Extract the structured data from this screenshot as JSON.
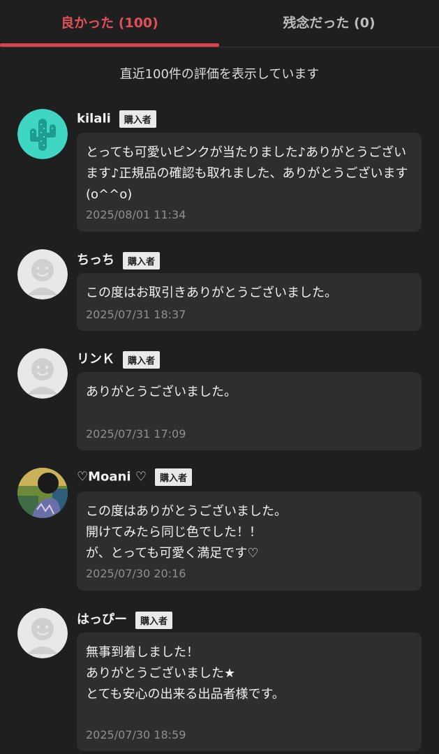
{
  "tabs": {
    "good_label": "良かった (100)",
    "bad_label": "残念だった (0)"
  },
  "notice": "直近100件の評価を表示しています",
  "badge_label": "購入者",
  "reviews": [
    {
      "name": "kilali",
      "avatar": "cactus-avatar",
      "comment": "とっても可愛いピンクが当たりました♪ありがとうございます♪正規品の確認も取れました、ありがとうございます (o^^o)",
      "date": "2025/08/01 11:34"
    },
    {
      "name": "ちっち",
      "avatar": "default-avatar",
      "comment": "この度はお取引きありがとうございました。",
      "date": "2025/07/31 18:37"
    },
    {
      "name": "リンＫ",
      "avatar": "default-avatar",
      "comment": "ありがとうございました。",
      "date": "2025/07/31 17:09"
    },
    {
      "name": "♡Moani ♡",
      "avatar": "photo-avatar",
      "comment": "この度はありがとうございました。\n開けてみたら同じ色でした！！\nが、とっても可愛く満足です♡",
      "date": "2025/07/30 20:16"
    },
    {
      "name": "はっぴー",
      "avatar": "default-avatar",
      "comment": "無事到着しました！\nありがとうございました★\nとても安心の出来る出品者様です。",
      "date": "2025/07/30 18:59"
    }
  ]
}
